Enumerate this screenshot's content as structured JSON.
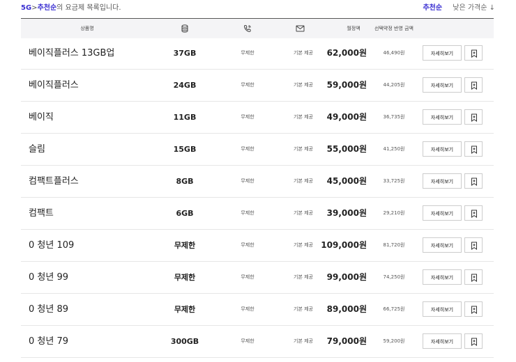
{
  "breadcrumb": {
    "network": "5G",
    "separator": ">",
    "sort_name": "추천순",
    "suffix": "의 요금제 목록입니다."
  },
  "sort": {
    "active": "추천순",
    "other": "낮은 가격순 ↓"
  },
  "header": {
    "name": "상품명",
    "monthly": "월정액",
    "discount": "선택약정 반영 금액",
    "data_icon": "database-icon",
    "call_icon": "phone-icon",
    "message_icon": "mail-icon"
  },
  "plans": [
    {
      "name": "베이직플러스 13GB업",
      "data": "37GB",
      "call": "무제한",
      "message": "기본 제공",
      "price": "62,000원",
      "discount": "46,490원",
      "detail": "자세히보기"
    },
    {
      "name": "베이직플러스",
      "data": "24GB",
      "call": "무제한",
      "message": "기본 제공",
      "price": "59,000원",
      "discount": "44,205원",
      "detail": "자세히보기"
    },
    {
      "name": "베이직",
      "data": "11GB",
      "call": "무제한",
      "message": "기본 제공",
      "price": "49,000원",
      "discount": "36,735원",
      "detail": "자세히보기"
    },
    {
      "name": "슬림",
      "data": "15GB",
      "call": "무제한",
      "message": "기본 제공",
      "price": "55,000원",
      "discount": "41,250원",
      "detail": "자세히보기"
    },
    {
      "name": "컴팩트플러스",
      "data": "8GB",
      "call": "무제한",
      "message": "기본 제공",
      "price": "45,000원",
      "discount": "33,725원",
      "detail": "자세히보기"
    },
    {
      "name": "컴팩트",
      "data": "6GB",
      "call": "무제한",
      "message": "기본 제공",
      "price": "39,000원",
      "discount": "29,210원",
      "detail": "자세히보기"
    },
    {
      "name": "0 청년 109",
      "data": "무제한",
      "call": "무제한",
      "message": "기본 제공",
      "price": "109,000원",
      "discount": "81,720원",
      "detail": "자세히보기"
    },
    {
      "name": "0 청년 99",
      "data": "무제한",
      "call": "무제한",
      "message": "기본 제공",
      "price": "99,000원",
      "discount": "74,250원",
      "detail": "자세히보기"
    },
    {
      "name": "0 청년 89",
      "data": "무제한",
      "call": "무제한",
      "message": "기본 제공",
      "price": "89,000원",
      "discount": "66,725원",
      "detail": "자세히보기"
    },
    {
      "name": "0 청년 79",
      "data": "300GB",
      "call": "무제한",
      "message": "기본 제공",
      "price": "79,000원",
      "discount": "59,200원",
      "detail": "자세히보기"
    }
  ]
}
